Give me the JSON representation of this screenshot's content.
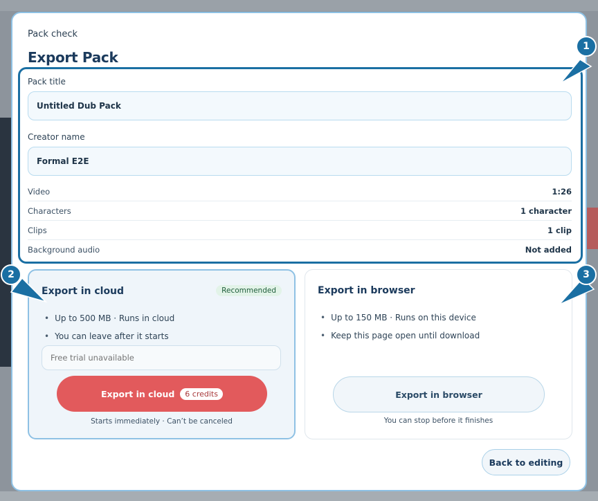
{
  "dialog": {
    "eyebrow": "Pack check",
    "title": "Export Pack"
  },
  "form": {
    "pack_title_label": "Pack title",
    "pack_title_value": "Untitled Dub Pack",
    "creator_label": "Creator name",
    "creator_value": "Formal E2E"
  },
  "summary": [
    {
      "label": "Video",
      "value": "1:26"
    },
    {
      "label": "Characters",
      "value": "1 character"
    },
    {
      "label": "Clips",
      "value": "1 clip"
    },
    {
      "label": "Background audio",
      "value": "Not added"
    }
  ],
  "cloud": {
    "title": "Export in cloud",
    "badge": "Recommended",
    "bullets": [
      "Up to 500 MB · Runs in cloud",
      "You can leave after it starts"
    ],
    "trial_placeholder": "Free trial unavailable",
    "button_label": "Export in cloud",
    "credits": "6 credits",
    "note": "Starts immediately · Can’t be canceled"
  },
  "browser": {
    "title": "Export in browser",
    "bullets": [
      "Up to 150 MB · Runs on this device",
      "Keep this page open until download"
    ],
    "button_label": "Export in browser",
    "note": "You can stop before it finishes"
  },
  "footer": {
    "back_label": "Back to editing"
  },
  "annotations": [
    "1",
    "2",
    "3"
  ],
  "colors": {
    "accent": "#1a6fa3",
    "cloud_button": "#e25a5c",
    "badge_bg": "#e2f3e8"
  }
}
